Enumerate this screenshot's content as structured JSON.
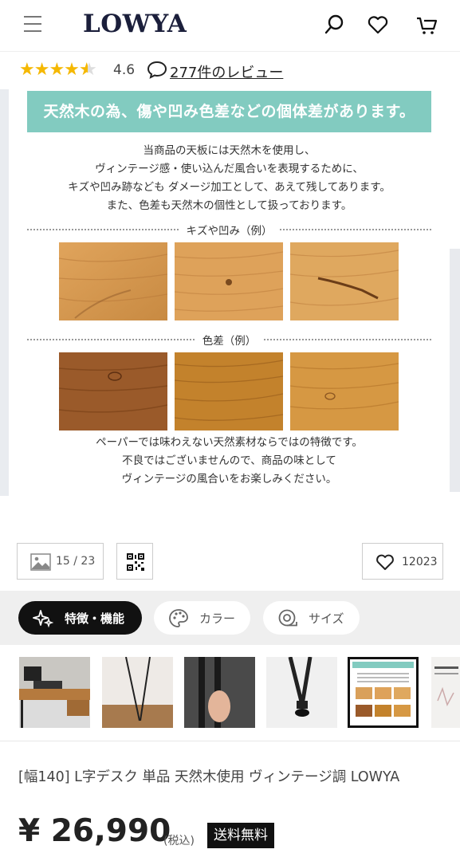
{
  "header": {
    "logo": "LOWYA",
    "icons": [
      "menu-icon",
      "search-icon",
      "heart-icon",
      "cart-icon"
    ]
  },
  "rating": {
    "stars_value": 4.6,
    "value_text": "4.6",
    "review_link": "277件のレビュー"
  },
  "banner": {
    "title": "天然木の為、傷や凹み色差などの個体差があります。",
    "description": [
      "当商品の天板には天然木を使用し、",
      "ヴィンテージ感・使い込んだ風合いを表現するために、",
      "キズや凹み跡なども ダメージ加工として、あえて残してあります。",
      "また、色差も天然木の個性として扱っております。"
    ],
    "section1_label": "キズや凹み（例）",
    "section2_label": "色差（例）",
    "footer": [
      "ペーパーでは味わえない天然素材ならではの特徴です。",
      "不良ではございませんので、商品の味として",
      "ヴィンテージの風合いをお楽しみください。"
    ]
  },
  "controls": {
    "image_counter": "15 / 23",
    "favorites_count": "12023"
  },
  "tabs": [
    {
      "label": "特徴・機能",
      "icon": "sparkle-icon",
      "active": true
    },
    {
      "label": "カラー",
      "icon": "palette-icon",
      "active": false
    },
    {
      "label": "サイズ",
      "icon": "measure-tape-icon",
      "active": false
    }
  ],
  "product": {
    "title": "[幅140] L字デスク 単品 天然木使用 ヴィンテージ調  LOWYA",
    "price": "¥ 26,990",
    "tax_label": "(税込)",
    "shipping_badge": "送料無料"
  },
  "colors": {
    "brand_navy": "#1b1f3b",
    "banner_teal": "#82cbc0",
    "star_yellow": "#f5b800"
  }
}
